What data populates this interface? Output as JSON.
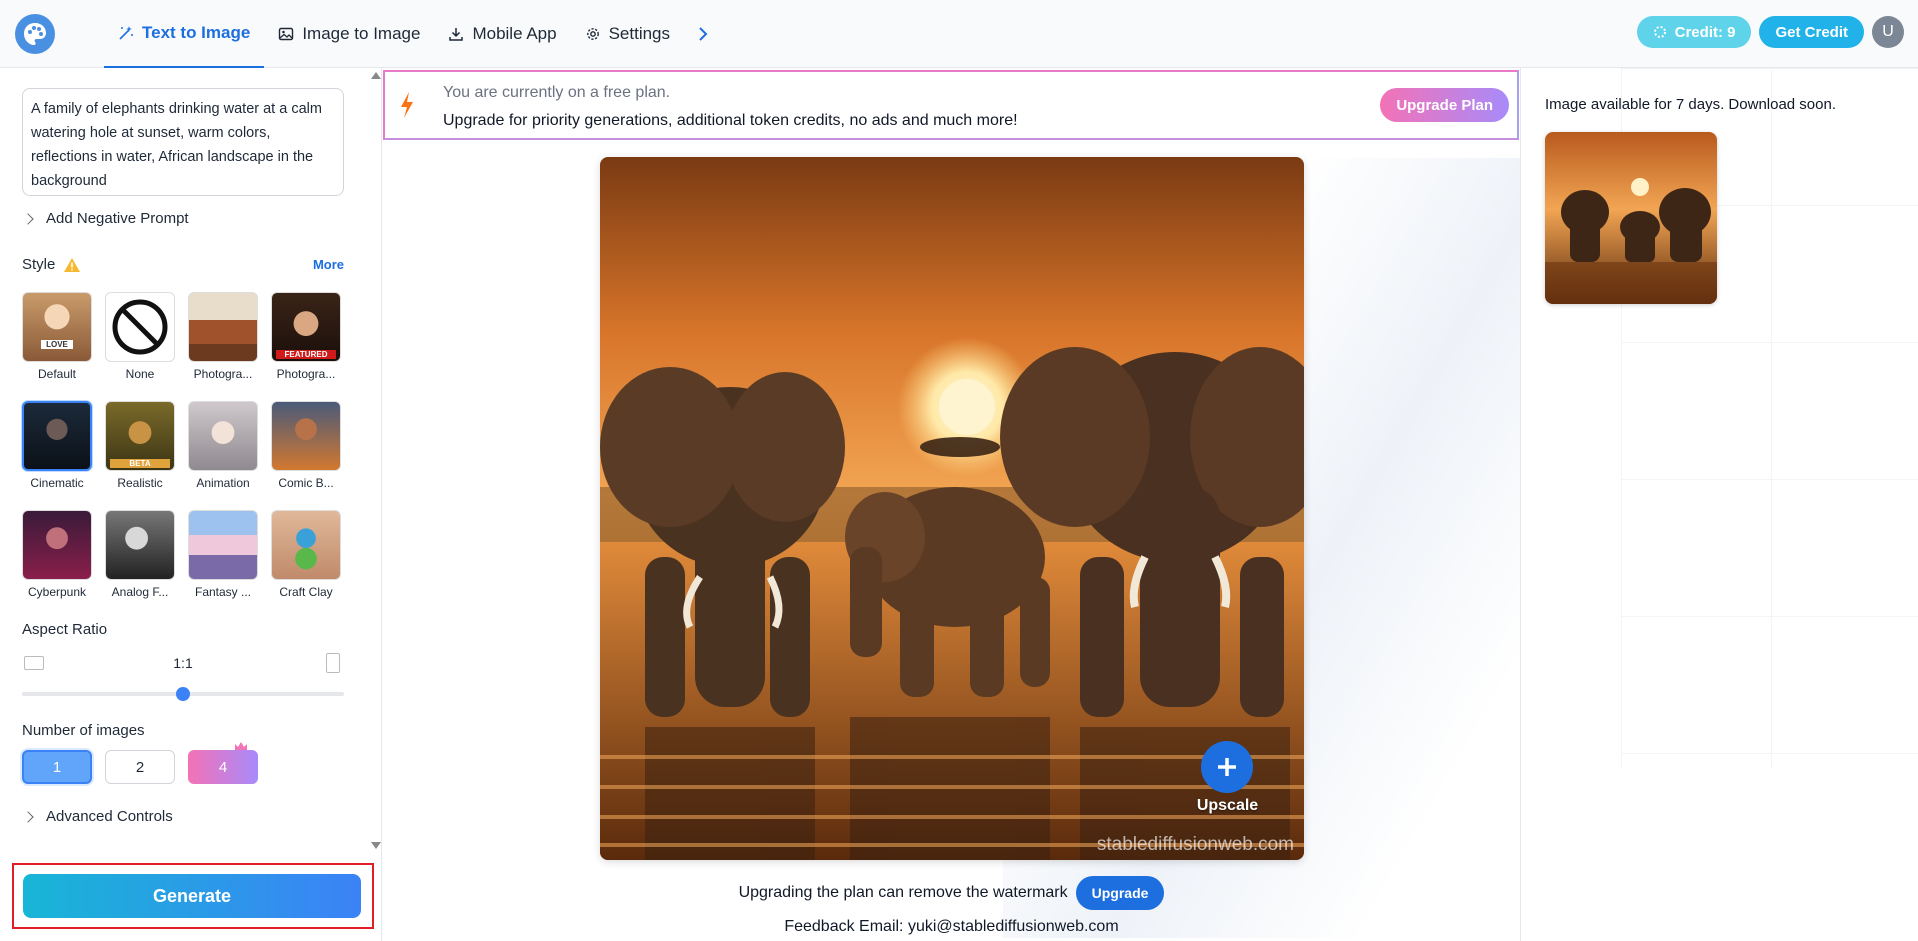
{
  "header": {
    "nav": [
      {
        "label": "Text to Image",
        "icon": "magic-wand-icon",
        "active": true
      },
      {
        "label": "Image to Image",
        "icon": "image-icon"
      },
      {
        "label": "Mobile App",
        "icon": "download-icon"
      },
      {
        "label": "Settings",
        "icon": "gear-icon"
      }
    ],
    "credit_label": "Credit: 9",
    "get_credit_label": "Get Credit",
    "avatar_initial": "U"
  },
  "left": {
    "prompt": "A family of elephants drinking water at a calm watering hole at sunset, warm colors, reflections in water, African landscape in the background",
    "negative_prompt_label": "Add Negative Prompt",
    "style_title": "Style",
    "more_label": "More",
    "styles": [
      {
        "label": "Default",
        "tag": "LOVE"
      },
      {
        "label": "None"
      },
      {
        "label": "Photogra..."
      },
      {
        "label": "Photogra...",
        "tag": "FEATURED"
      },
      {
        "label": "Cinematic",
        "selected": true
      },
      {
        "label": "Realistic",
        "tag": "BETA"
      },
      {
        "label": "Animation"
      },
      {
        "label": "Comic B..."
      },
      {
        "label": "Cyberpunk"
      },
      {
        "label": "Analog F..."
      },
      {
        "label": "Fantasy ..."
      },
      {
        "label": "Craft Clay"
      }
    ],
    "aspect_title": "Aspect Ratio",
    "aspect_value": "1:1",
    "aspect_slider_fraction": 0.5,
    "number_title": "Number of images",
    "numbers": [
      "1",
      "2",
      "4"
    ],
    "advanced_label": "Advanced Controls",
    "generate_label": "Generate"
  },
  "banner": {
    "line1": "You are currently on a free plan.",
    "line2": "Upgrade for priority generations, additional token credits, no ads and much more!",
    "button": "Upgrade Plan"
  },
  "main": {
    "upscale_label": "Upscale",
    "watermark": "stablediffusionweb.com",
    "watermark_note": "Upgrading the plan can remove the watermark",
    "upgrade_label": "Upgrade",
    "feedback": "Feedback Email: yuki@stablediffusionweb.com"
  },
  "right": {
    "availability": "Image available for 7 days. Download soon."
  }
}
